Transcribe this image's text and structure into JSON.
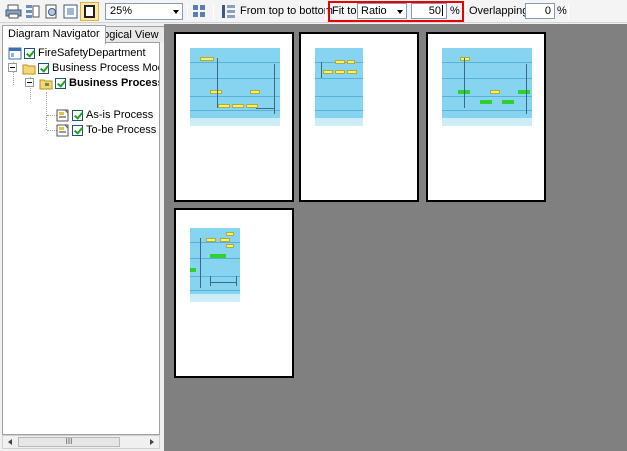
{
  "toolbar": {
    "zoom_value": "25%",
    "order_label": "From top to bottom",
    "fit_label": "Fit to:",
    "fit_mode": "Ratio",
    "fit_value": "50",
    "fit_unit": "%",
    "overlap_label": "Overlapping:",
    "overlap_value": "0",
    "overlap_unit": "%"
  },
  "tabs": [
    {
      "label": "Diagram Navigator",
      "active": true
    },
    {
      "label": "Logical View",
      "active": false
    }
  ],
  "tree": {
    "root": "FireSafetyDepartment",
    "model": "Business Process Modeling",
    "group": "Business Process D",
    "items": [
      "As-is Process",
      "To-be Process"
    ]
  },
  "scrollbar": {
    "thumb_grip": "III"
  },
  "pages": [
    {
      "id": 1
    },
    {
      "id": 2
    },
    {
      "id": 3
    },
    {
      "id": 4
    }
  ],
  "colors": {
    "highlight_border": "#e60000",
    "preview_bg": "#808080",
    "diagram_fill": "#87d4f0",
    "task_yellow": "#f3f07a",
    "task_green": "#2ed12e"
  }
}
